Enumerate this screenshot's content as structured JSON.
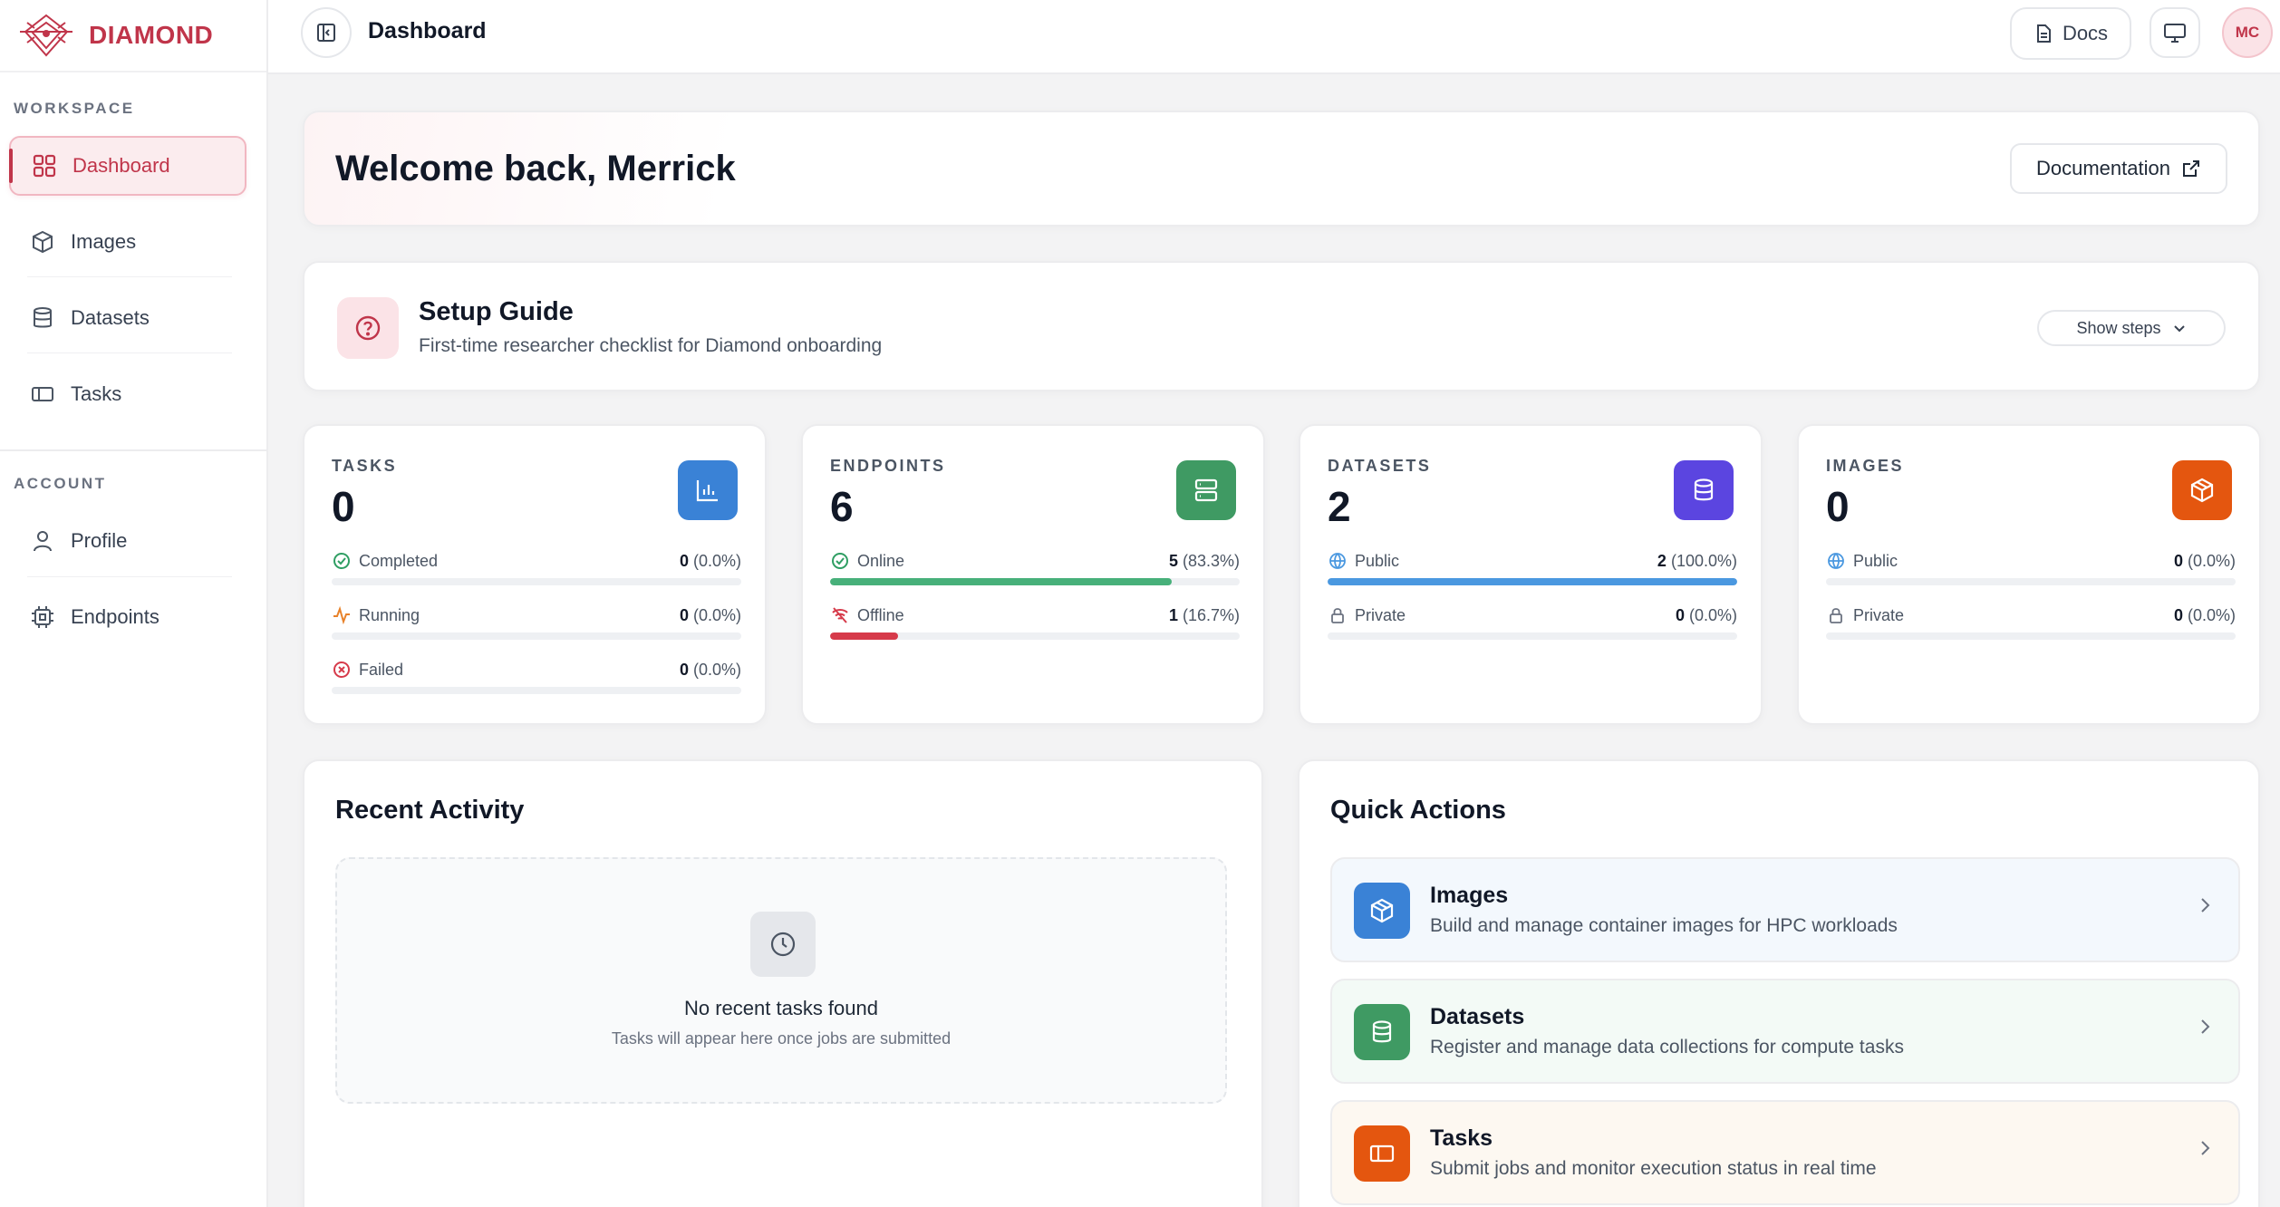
{
  "brand": {
    "name": "DIAMOND"
  },
  "sidebar": {
    "workspace_label": "WORKSPACE",
    "account_label": "ACCOUNT",
    "workspace_items": [
      {
        "label": "Dashboard",
        "icon": "grid-icon"
      },
      {
        "label": "Images",
        "icon": "box-icon"
      },
      {
        "label": "Datasets",
        "icon": "database-icon"
      },
      {
        "label": "Tasks",
        "icon": "panel-icon"
      }
    ],
    "account_items": [
      {
        "label": "Profile",
        "icon": "user-icon"
      },
      {
        "label": "Endpoints",
        "icon": "cpu-icon"
      }
    ]
  },
  "header": {
    "title": "Dashboard",
    "docs_label": "Docs",
    "avatar_initials": "MC"
  },
  "welcome": {
    "title": "Welcome back, Merrick",
    "documentation_label": "Documentation"
  },
  "setup": {
    "title": "Setup Guide",
    "subtitle": "First-time researcher checklist for Diamond onboarding",
    "toggle_label": "Show steps"
  },
  "stats": {
    "tasks": {
      "label": "TASKS",
      "value": "0",
      "color": "#3a82d6",
      "rows": [
        {
          "label": "Completed",
          "count": "0",
          "pct": "(0.0%)",
          "fill": 0,
          "color": "#2f9e63"
        },
        {
          "label": "Running",
          "count": "0",
          "pct": "(0.0%)",
          "fill": 0,
          "color": "#e8822a"
        },
        {
          "label": "Failed",
          "count": "0",
          "pct": "(0.0%)",
          "fill": 0,
          "color": "#d63a4a"
        }
      ]
    },
    "endpoints": {
      "label": "ENDPOINTS",
      "value": "6",
      "color": "#3f9a63",
      "rows": [
        {
          "label": "Online",
          "count": "5",
          "pct": "(83.3%)",
          "fill": 0.833,
          "color": "#47b07a"
        },
        {
          "label": "Offline",
          "count": "1",
          "pct": "(16.7%)",
          "fill": 0.167,
          "color": "#d63a4a"
        }
      ]
    },
    "datasets": {
      "label": "DATASETS",
      "value": "2",
      "color": "#5b45e0",
      "rows": [
        {
          "label": "Public",
          "count": "2",
          "pct": "(100.0%)",
          "fill": 1.0,
          "color": "#4a98e0"
        },
        {
          "label": "Private",
          "count": "0",
          "pct": "(0.0%)",
          "fill": 0,
          "color": "#9ca3af"
        }
      ]
    },
    "images": {
      "label": "IMAGES",
      "value": "0",
      "color": "#e4560f",
      "rows": [
        {
          "label": "Public",
          "count": "0",
          "pct": "(0.0%)",
          "fill": 0,
          "color": "#4a98e0"
        },
        {
          "label": "Private",
          "count": "0",
          "pct": "(0.0%)",
          "fill": 0,
          "color": "#9ca3af"
        }
      ]
    }
  },
  "activity": {
    "title": "Recent Activity",
    "empty_title": "No recent tasks found",
    "empty_subtitle": "Tasks will appear here once jobs are submitted"
  },
  "quick_actions": {
    "title": "Quick Actions",
    "items": [
      {
        "title": "Images",
        "subtitle": "Build and manage container images for HPC workloads",
        "color": "#3a82d6",
        "bg": "#f3f8fd"
      },
      {
        "title": "Datasets",
        "subtitle": "Register and manage data collections for compute tasks",
        "color": "#3f9a63",
        "bg": "#f3faf6"
      },
      {
        "title": "Tasks",
        "subtitle": "Submit jobs and monitor execution status in real time",
        "color": "#e4560f",
        "bg": "#fdf8f1"
      }
    ]
  }
}
